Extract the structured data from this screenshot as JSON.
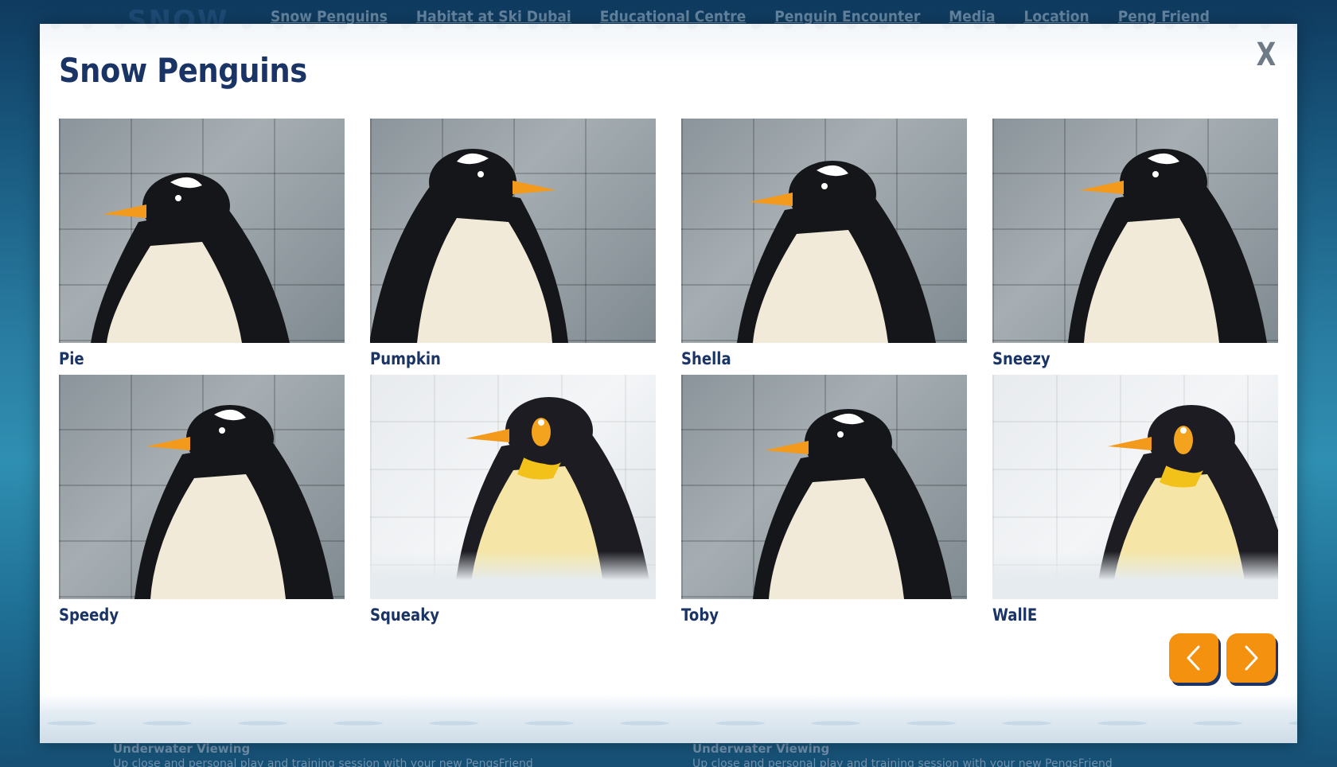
{
  "background": {
    "logo_text": "SNOW",
    "nav": [
      "Snow Penguins",
      "Habitat at Ski Dubai",
      "Educational Centre",
      "Penguin Encounter",
      "Media",
      "Location",
      "Peng Friend"
    ],
    "footer_left": {
      "title": "Underwater Viewing",
      "desc": "Up close and personal play and training session with your new PengsFriend"
    },
    "footer_right": {
      "title": "Underwater Viewing",
      "desc": "Up close and personal play and training session with your new PengsFriend"
    }
  },
  "modal": {
    "title": "Snow Penguins",
    "close_label": "X",
    "penguins": [
      {
        "name": "Pie",
        "icon": "gentoo-penguin",
        "bg": "wall"
      },
      {
        "name": "Pumpkin",
        "icon": "gentoo-penguin",
        "bg": "wall"
      },
      {
        "name": "Shella",
        "icon": "gentoo-penguin",
        "bg": "wall"
      },
      {
        "name": "Sneezy",
        "icon": "gentoo-penguin",
        "bg": "wall"
      },
      {
        "name": "Speedy",
        "icon": "gentoo-penguin",
        "bg": "wall"
      },
      {
        "name": "Squeaky",
        "icon": "king-penguin",
        "bg": "snowwall"
      },
      {
        "name": "Toby",
        "icon": "gentoo-penguin",
        "bg": "wall"
      },
      {
        "name": "WallE",
        "icon": "king-penguin",
        "bg": "snowwall"
      }
    ],
    "prev_icon": "chevron-left-icon",
    "next_icon": "chevron-right-icon"
  },
  "colors": {
    "accent": "#f4920f",
    "title": "#1a3466"
  }
}
